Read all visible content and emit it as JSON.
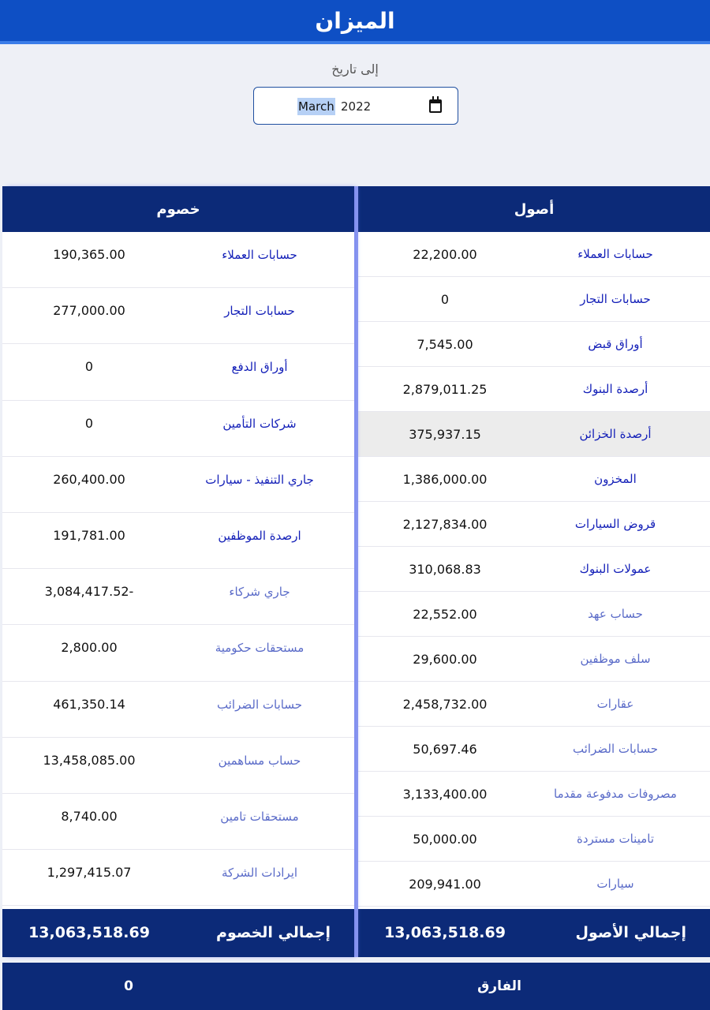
{
  "header": {
    "title": "الميزان"
  },
  "date_filter": {
    "label": "إلى تاريخ",
    "month": "March",
    "year": "2022"
  },
  "assets": {
    "title": "أصول",
    "rows": [
      {
        "label": "حسابات العملاء",
        "value": "22,200.00"
      },
      {
        "label": "حسابات التجار",
        "value": "0"
      },
      {
        "label": "أوراق قبض",
        "value": "7,545.00"
      },
      {
        "label": "أرصدة البنوك",
        "value": "2,879,011.25"
      },
      {
        "label": "أرصدة الخزائن",
        "value": "375,937.15"
      },
      {
        "label": "المخزون",
        "value": "1,386,000.00"
      },
      {
        "label": "قروض السيارات",
        "value": "2,127,834.00"
      },
      {
        "label": "عمولات البنوك",
        "value": "310,068.83"
      },
      {
        "label": "حساب عهد",
        "value": "22,552.00"
      },
      {
        "label": "سلف موظفين",
        "value": "29,600.00"
      },
      {
        "label": "عقارات",
        "value": "2,458,732.00"
      },
      {
        "label": "حسابات الضرائب",
        "value": "50,697.46"
      },
      {
        "label": "مصروفات مدفوعة مقدما",
        "value": "3,133,400.00"
      },
      {
        "label": "تامينات مستردة",
        "value": "50,000.00"
      },
      {
        "label": "سيارات",
        "value": "209,941.00"
      }
    ],
    "total_label": "إجمالي الأصول",
    "total_value": "13,063,518.69"
  },
  "liabilities": {
    "title": "خصوم",
    "rows": [
      {
        "label": "حسابات العملاء",
        "value": "190,365.00"
      },
      {
        "label": "حسابات التجار",
        "value": "277,000.00"
      },
      {
        "label": "أوراق الدفع",
        "value": "0"
      },
      {
        "label": "شركات التأمين",
        "value": "0"
      },
      {
        "label": "جاري التنفيذ - سيارات",
        "value": "260,400.00"
      },
      {
        "label": "ارصدة الموظفين",
        "value": "191,781.00"
      },
      {
        "label": "جاري شركاء",
        "value": "-3,084,417.52"
      },
      {
        "label": "مستحقات حكومية",
        "value": "2,800.00"
      },
      {
        "label": "حسابات الضرائب",
        "value": "461,350.14"
      },
      {
        "label": "حساب مساهمين",
        "value": "13,458,085.00"
      },
      {
        "label": "مستحقات تامين",
        "value": "8,740.00"
      },
      {
        "label": "ايرادات الشركة",
        "value": "1,297,415.07"
      }
    ],
    "total_label": "إجمالي الخصوم",
    "total_value": "13,063,518.69"
  },
  "difference": {
    "label": "الفارق",
    "value": "0"
  },
  "colors": {
    "header": "#0e4fc4",
    "panel_head": "#0c2a78",
    "link_dark": "#1420b8",
    "link_light": "#5a6bc8",
    "highlight_row": "#ececec"
  }
}
